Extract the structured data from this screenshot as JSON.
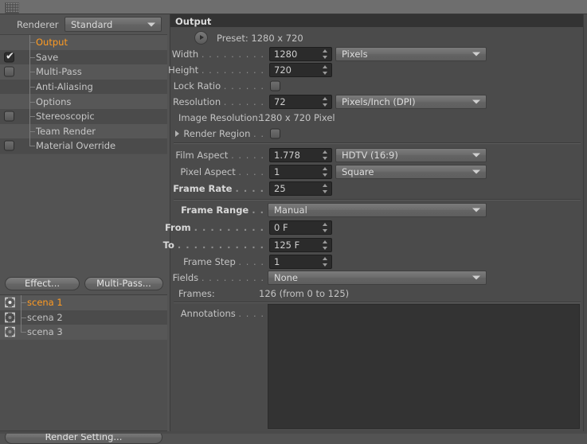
{
  "window": {
    "grip_icon": "grip-dots-icon"
  },
  "left": {
    "renderer": {
      "label": "Renderer",
      "value": "Standard",
      "arrow_icon": "chevron-down-icon"
    },
    "tree": [
      {
        "label": "Output",
        "selected": true,
        "checkbox": "none"
      },
      {
        "label": "Save",
        "selected": false,
        "checkbox": "checked"
      },
      {
        "label": "Multi-Pass",
        "selected": false,
        "checkbox": "unchecked"
      },
      {
        "label": "Anti-Aliasing",
        "selected": false,
        "checkbox": "none"
      },
      {
        "label": "Options",
        "selected": false,
        "checkbox": "none"
      },
      {
        "label": "Stereoscopic",
        "selected": false,
        "checkbox": "unchecked"
      },
      {
        "label": "Team Render",
        "selected": false,
        "checkbox": "none"
      },
      {
        "label": "Material Override",
        "selected": false,
        "checkbox": "unchecked"
      }
    ],
    "buttons": {
      "effect": "Effect...",
      "multipass": "Multi-Pass...",
      "render_setting": "Render Setting..."
    },
    "scenes": [
      {
        "label": "scena 1",
        "selected": true,
        "icon": "render-target-icon"
      },
      {
        "label": "scena 2",
        "selected": false,
        "icon": "render-target-icon"
      },
      {
        "label": "scena 3",
        "selected": false,
        "icon": "render-target-icon"
      }
    ]
  },
  "output": {
    "section_title": "Output",
    "preset": {
      "button_icon": "play-triangle-icon",
      "text": "Preset: 1280 x 720"
    },
    "width": {
      "label": "Width",
      "dots": ". . . . . . . . .",
      "value": "1280",
      "unit": "Pixels",
      "unit_arrow": "chevron-down-icon"
    },
    "height": {
      "label": "Height",
      "dots": ". . . . . . . . .",
      "value": "720"
    },
    "lock_ratio": {
      "label": "Lock Ratio",
      "dots": ". . . . . .",
      "checked": false
    },
    "resolution": {
      "label": "Resolution",
      "dots": ". . . . . .",
      "value": "72",
      "unit": "Pixels/Inch (DPI)",
      "unit_arrow": "chevron-down-icon"
    },
    "image_resolution": {
      "label": "Image Resolution:",
      "value": "1280 x 720 Pixel"
    },
    "render_region": {
      "label": "Render Region",
      "dots": ". .",
      "checked": false,
      "expander_icon": "triangle-right-icon"
    },
    "film_aspect": {
      "label": "Film Aspect",
      "dots": ". . . . .",
      "value": "1.778",
      "preset": "HDTV (16:9)",
      "arrow": "chevron-down-icon"
    },
    "pixel_aspect": {
      "label": "Pixel Aspect",
      "dots": ". . . .",
      "value": "1",
      "preset": "Square",
      "arrow": "chevron-down-icon"
    },
    "frame_rate": {
      "label": "Frame Rate",
      "dots": ". . . .",
      "value": "25"
    },
    "frame_range": {
      "label": "Frame Range",
      "dots": ". .",
      "value": "Manual",
      "arrow": "chevron-down-icon"
    },
    "from": {
      "label": "From",
      "dots": ". . . . . . . . .",
      "value": "0 F"
    },
    "to": {
      "label": "To",
      "dots": ". . . . . . . . . . .",
      "value": "125 F"
    },
    "frame_step": {
      "label": "Frame Step",
      "dots": ". . . .",
      "value": "1"
    },
    "fields": {
      "label": "Fields",
      "dots": ". . . . . . . . .",
      "value": "None",
      "arrow": "chevron-down-icon"
    },
    "frames": {
      "label": "Frames:",
      "value": "126 (from 0 to 125)"
    },
    "annotations": {
      "label": "Annotations",
      "dots": ". . . .",
      "value": ""
    }
  },
  "colors": {
    "accent": "#ff9b22",
    "panel": "#4b4b4b",
    "chrome": "#535353",
    "field": "#2b2b2b",
    "header": "#333333"
  }
}
